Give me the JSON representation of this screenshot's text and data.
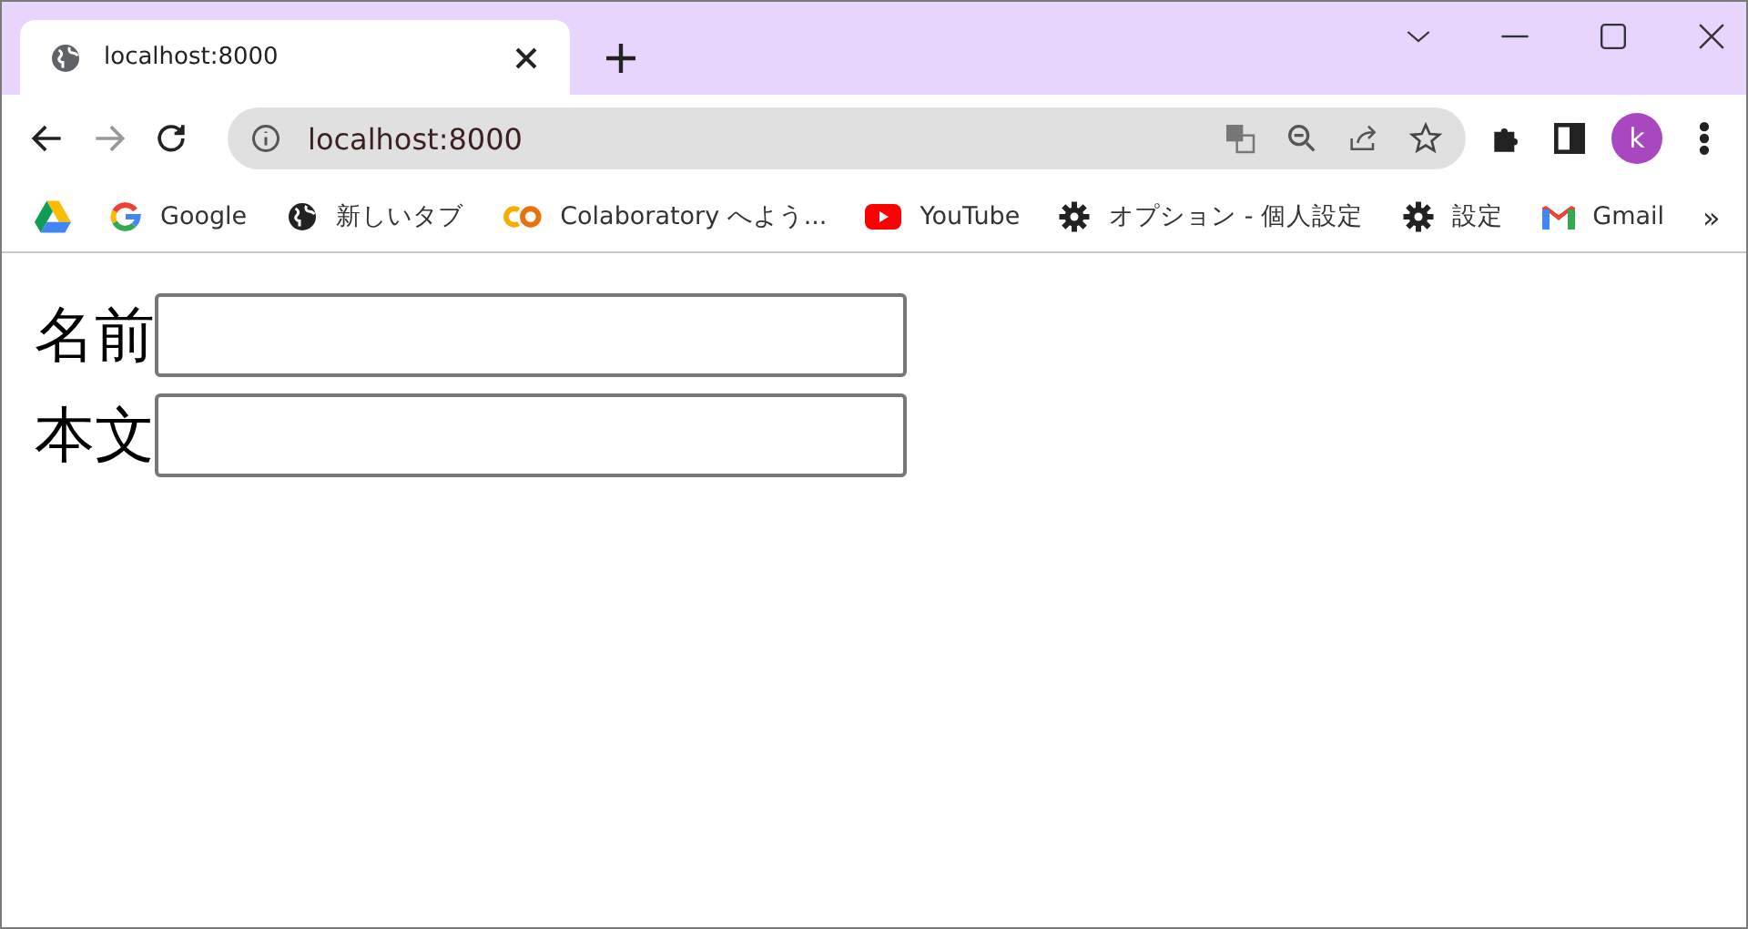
{
  "tab": {
    "title": "localhost:8000",
    "selected": true
  },
  "address": {
    "value": "localhost:8000"
  },
  "profile": {
    "initial": "k"
  },
  "bookmarks": [
    {
      "label": "Google"
    },
    {
      "label": "新しいタブ"
    },
    {
      "label": "Colaboratory へよう..."
    },
    {
      "label": "YouTube"
    },
    {
      "label": "オプション - 個人設定"
    },
    {
      "label": "設定"
    },
    {
      "label": "Gmail"
    }
  ],
  "bookmarks_more": "»",
  "form": [
    {
      "label": "名前"
    },
    {
      "label": "本文"
    }
  ]
}
